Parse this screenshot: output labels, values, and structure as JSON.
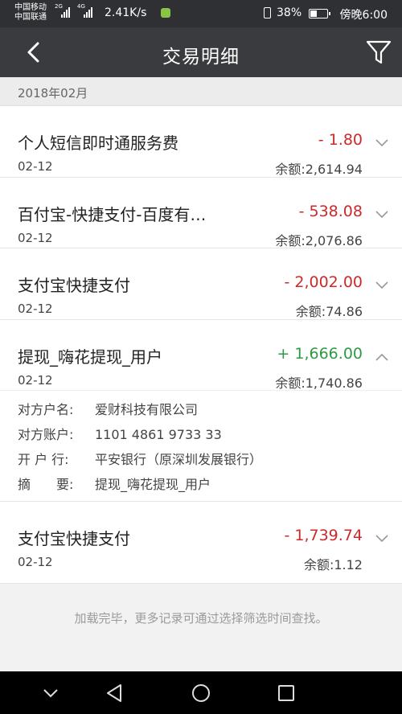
{
  "statusbar": {
    "carrier1": "中国移动",
    "carrier2": "中国联通",
    "net1": "2G",
    "net2": "4G",
    "speed": "2.41K/s",
    "battery_pct": "38%",
    "battery_level": 0.38,
    "time": "傍晚6:00"
  },
  "header": {
    "title": "交易明细",
    "back_icon": "back-chevron-icon",
    "filter_icon": "filter-funnel-icon"
  },
  "month": "2018年02月",
  "transactions": [
    {
      "name": "个人短信即时通服务费",
      "date": "02-12",
      "amount": "- 1.80",
      "balance": "余额:2,614.94",
      "type": "debit",
      "expanded": false
    },
    {
      "name": "百付宝-快捷支付-百度有…",
      "date": "02-12",
      "amount": "- 538.08",
      "balance": "余额:2,076.86",
      "type": "debit",
      "expanded": false
    },
    {
      "name": "支付宝快捷支付",
      "date": "02-12",
      "amount": "- 2,002.00",
      "balance": "余额:74.86",
      "type": "debit",
      "expanded": false
    },
    {
      "name": "提现_嗨花提现_用户",
      "date": "02-12",
      "amount": "+ 1,666.00",
      "balance": "余额:1,740.86",
      "type": "credit",
      "expanded": true
    },
    {
      "name": "支付宝快捷支付",
      "date": "02-12",
      "amount": "- 1,739.74",
      "balance": "余额:1.12",
      "type": "debit",
      "expanded": false
    }
  ],
  "details": {
    "counterparty_label": "对方户名:",
    "counterparty": "爱财科技有限公司",
    "account_label": "对方账户:",
    "account": "1101 4861 9733 33",
    "bank_label": "开 户 行:",
    "bank": "平安银行（原深圳发展银行）",
    "memo_label": "摘　　要:",
    "memo": "提现_嗨花提现_用户"
  },
  "footer_note": "加载完毕，更多记录可通过选择筛选时间查找。",
  "colors": {
    "debit": "#cc2a2a",
    "credit": "#2e9a44",
    "navbar": "#3a3b3e"
  }
}
